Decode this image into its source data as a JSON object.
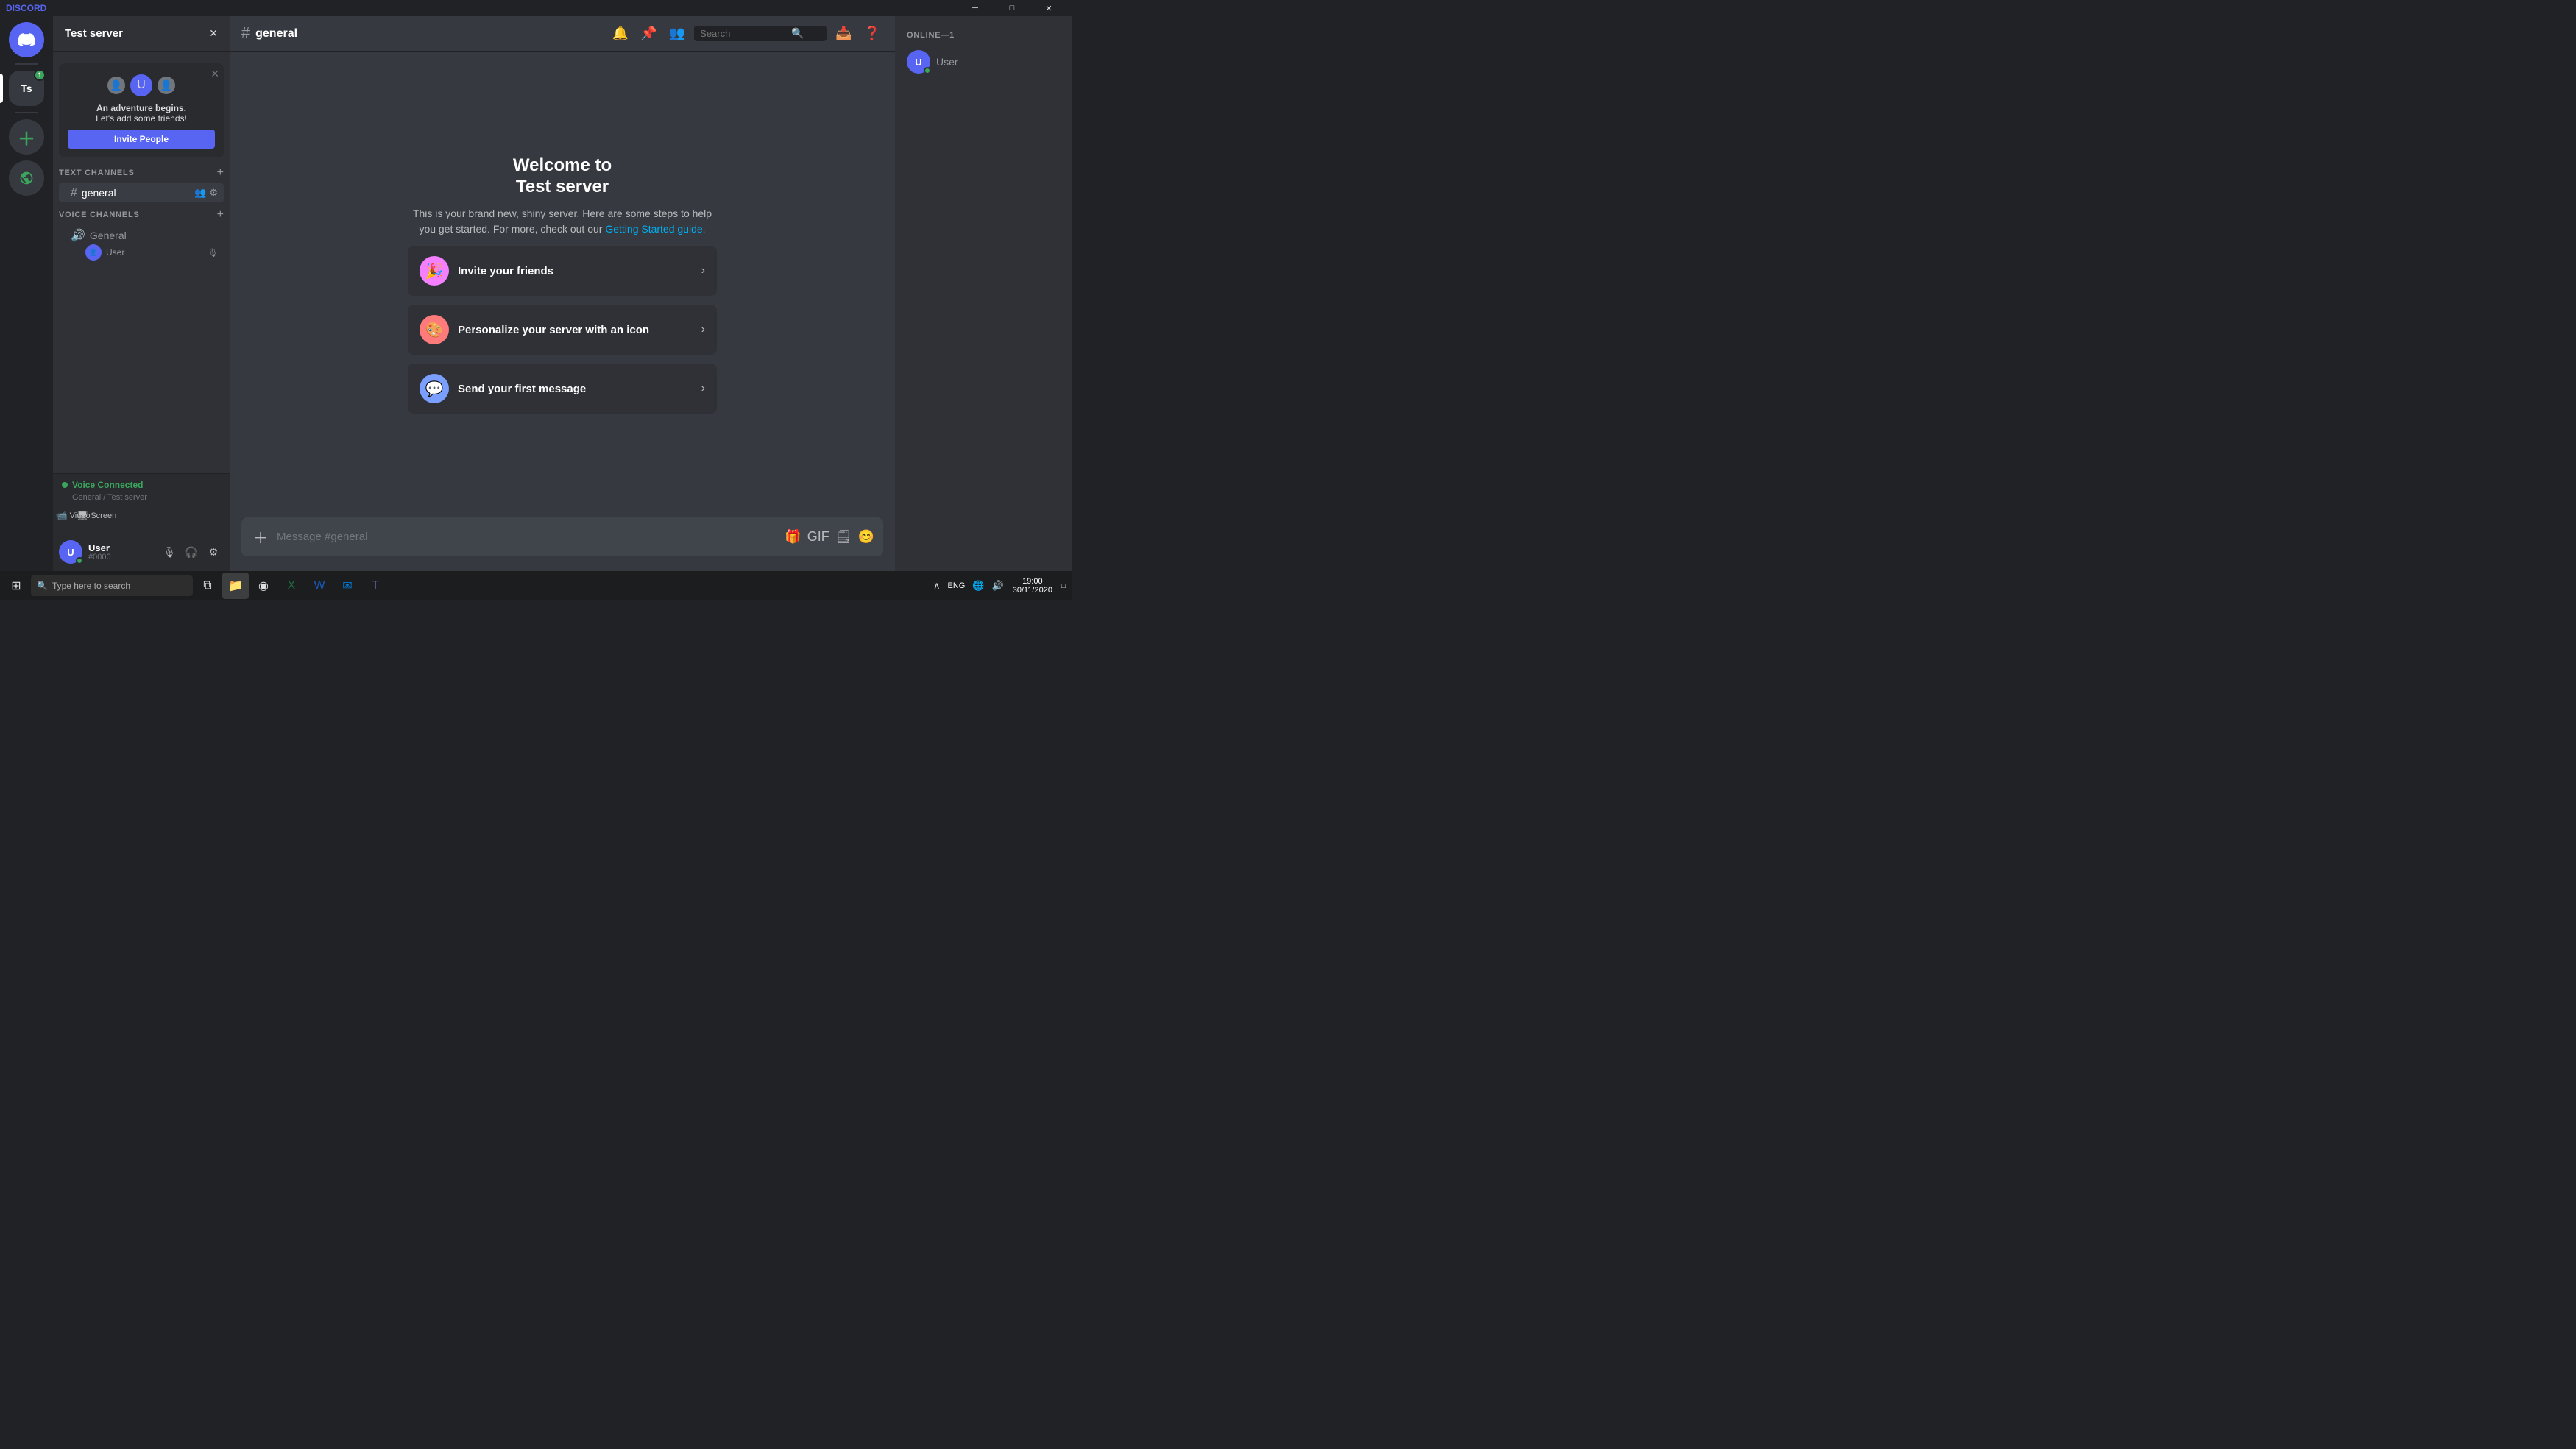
{
  "app": {
    "title": "DISCORD",
    "window_controls": {
      "minimize": "─",
      "maximize": "□",
      "close": "✕"
    }
  },
  "server_list": {
    "discord_home_icon": "🎮",
    "servers": [
      {
        "id": "ts",
        "label": "Ts",
        "active": true,
        "badge": "1"
      }
    ],
    "add_server_label": "+",
    "explore_label": "🧭"
  },
  "channel_sidebar": {
    "server_name": "Test server",
    "invite_popup": {
      "title": "An adventure begins.",
      "subtitle": "Let's add some friends!",
      "button_label": "Invite People"
    },
    "text_channels_section": {
      "label": "TEXT CHANNELS",
      "add_label": "+"
    },
    "text_channels": [
      {
        "id": "general",
        "name": "general",
        "active": true
      }
    ],
    "voice_channels_section": {
      "label": "VOICE CHANNELS",
      "add_label": "+"
    },
    "voice_channels": [
      {
        "id": "general-voice",
        "name": "General",
        "users": [
          {
            "name": "User",
            "avatar": "👤"
          }
        ]
      }
    ]
  },
  "voice_connected": {
    "status": "Voice Connected",
    "server": "General / Test server",
    "video_label": "Video",
    "screen_label": "Screen"
  },
  "user_area": {
    "name": "User",
    "tag": "#0000",
    "avatar_text": "U"
  },
  "channel_header": {
    "icon": "#",
    "name": "general",
    "search_placeholder": "Search"
  },
  "welcome": {
    "title_line1": "Welcome to",
    "title_line2": "Test server",
    "description": "This is your brand new, shiny server. Here are some steps to help you get started. For more, check out our",
    "description_link": "Getting Started guide.",
    "actions": [
      {
        "id": "invite-friends",
        "emoji": "🎉",
        "label": "Invite your friends",
        "emoji_bg": "#f47fff"
      },
      {
        "id": "personalize",
        "emoji": "🎨",
        "label": "Personalize your server with an icon",
        "emoji_bg": "#ff7b7b"
      },
      {
        "id": "first-message",
        "emoji": "💬",
        "label": "Send your first message",
        "emoji_bg": "#7b9fff"
      }
    ]
  },
  "message_input": {
    "placeholder": "Message #general"
  },
  "member_list": {
    "section_label": "ONLINE—1",
    "members": [
      {
        "name": "User",
        "avatar_text": "U",
        "status": "online"
      }
    ]
  },
  "taskbar": {
    "search_placeholder": "Type here to search",
    "time": "19:00",
    "date": "30/11/2020",
    "apps": [
      {
        "id": "start",
        "icon": "⊞"
      },
      {
        "id": "search",
        "icon": "🔍"
      },
      {
        "id": "taskview",
        "icon": "⧉"
      },
      {
        "id": "explorer",
        "icon": "📁"
      },
      {
        "id": "chrome",
        "icon": "◉"
      },
      {
        "id": "excel",
        "icon": "📊"
      },
      {
        "id": "word",
        "icon": "📝"
      },
      {
        "id": "outlook",
        "icon": "📧"
      },
      {
        "id": "teams",
        "icon": "🟦"
      }
    ],
    "tray_icons": [
      "🔔",
      "🌐",
      "🔊",
      "⌨"
    ]
  }
}
